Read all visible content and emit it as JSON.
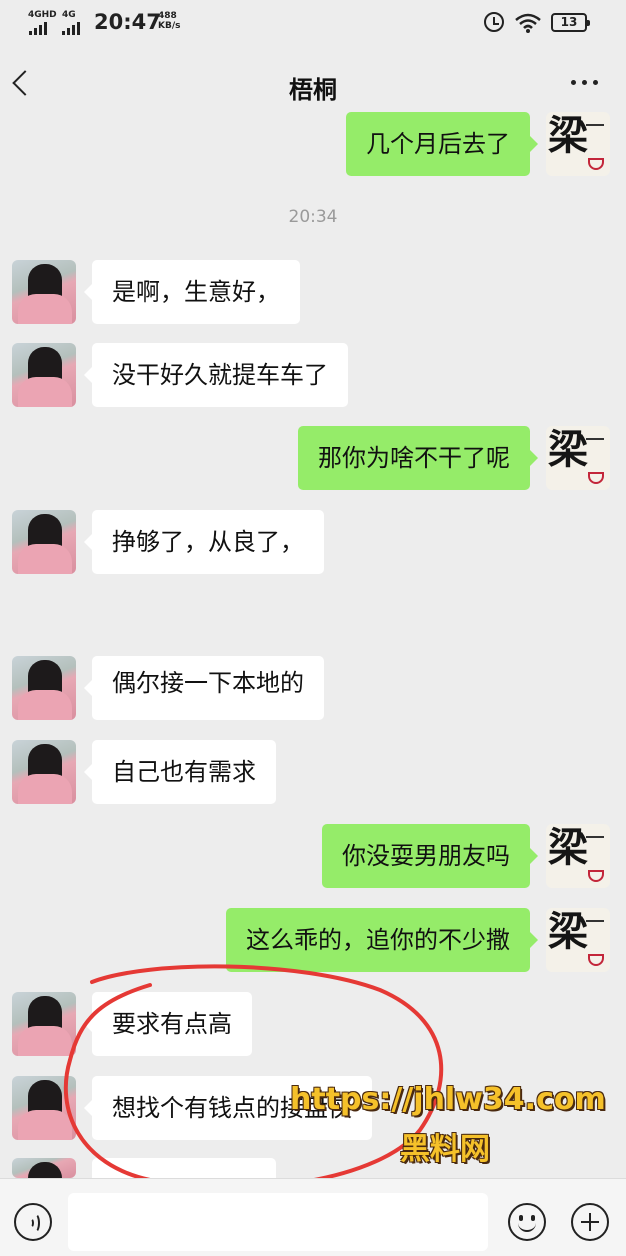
{
  "status_bar": {
    "network1": "4GHD",
    "network2": "4G",
    "time": "20:47",
    "speed_value": "488",
    "speed_unit": "KB/s",
    "battery": "13"
  },
  "header": {
    "title": "梧桐",
    "back_icon": "chevron-left-icon",
    "more_icon": "more-horizontal-icon"
  },
  "messages": [
    {
      "side": "out",
      "text": "几个月后去了"
    },
    {
      "side": "in",
      "text": "是啊，生意好，"
    },
    {
      "side": "in",
      "text": "没干好久就提车车了"
    },
    {
      "side": "out",
      "text": "那你为啥不干了呢"
    },
    {
      "side": "in",
      "text": "挣够了，从良了，"
    },
    {
      "side": "in",
      "text": "偶尔接一下本地的"
    },
    {
      "side": "in",
      "text": "自己也有需求"
    },
    {
      "side": "out",
      "text": "你没耍男朋友吗"
    },
    {
      "side": "out",
      "text": "这么乖的，追你的不少撒"
    },
    {
      "side": "in",
      "text": "要求有点高"
    },
    {
      "side": "in",
      "text": "想找个有钱点的接盘侠"
    }
  ],
  "timestamp": "20:34",
  "avatars": {
    "contact": "girl-avatar",
    "self": "liang-calligraphy-avatar"
  },
  "self_avatar_text": "梁",
  "watermark": {
    "url": "https://jhlw34.com",
    "name": "黑料网"
  },
  "input_bar": {
    "voice_icon": "voice-icon",
    "emoji_icon": "emoji-icon",
    "plus_icon": "plus-icon"
  },
  "colors": {
    "background": "#ededed",
    "outgoing_bubble": "#95ec69",
    "incoming_bubble": "#ffffff",
    "annotation_circle": "#e53935",
    "watermark": "#f5c12a"
  }
}
